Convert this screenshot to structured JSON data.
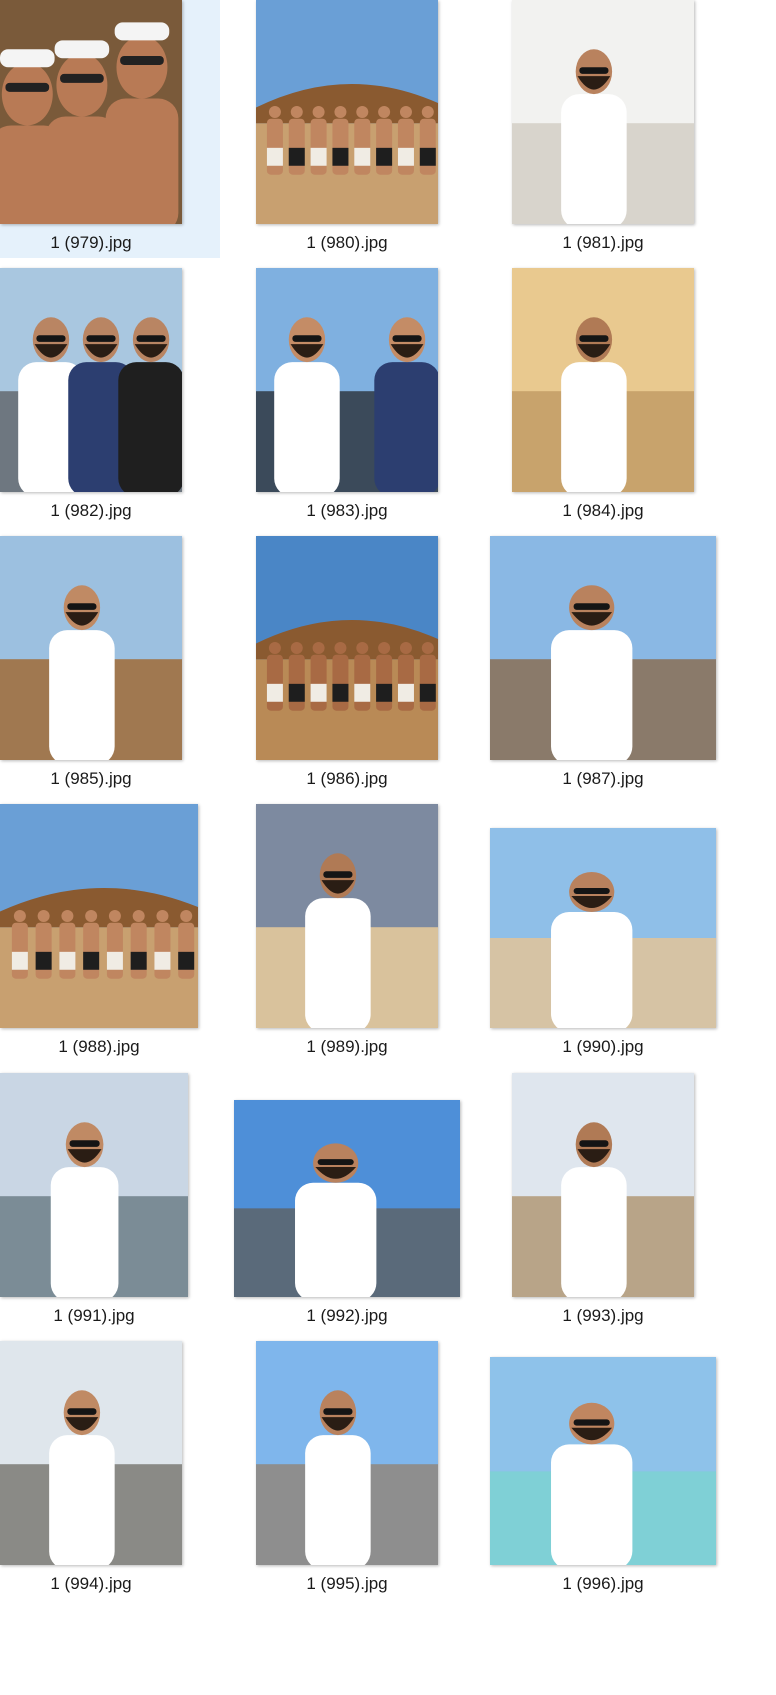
{
  "window": {
    "view": "Large icons",
    "selected_file": "1 (979).jpg"
  },
  "colors": {
    "selection": "#e5f1fb",
    "label_text": "#1a1a1a"
  },
  "files": [
    {
      "name": "1 (979).jpg",
      "selected": true,
      "scene": "selfie",
      "sky": "#c89a62",
      "ground": "#7a5a3a",
      "skin": "#b87a55"
    },
    {
      "name": "1 (980).jpg",
      "selected": false,
      "scene": "beach-group",
      "sky": "#6a9fd6",
      "ground": "#c8a070",
      "skin": "#c08660"
    },
    {
      "name": "1 (981).jpg",
      "selected": false,
      "scene": "street",
      "sky": "#f2f2f0",
      "ground": "#d8d4cc",
      "skin": "#b9825e"
    },
    {
      "name": "1 (982).jpg",
      "selected": false,
      "scene": "coast-group",
      "sky": "#a9c7e0",
      "ground": "#6e7780",
      "skin": "#b98563"
    },
    {
      "name": "1 (983).jpg",
      "selected": false,
      "scene": "city-selfie",
      "sky": "#7fb0e0",
      "ground": "#3b4a5a",
      "skin": "#c48c66"
    },
    {
      "name": "1 (984).jpg",
      "selected": false,
      "scene": "sunset-beach",
      "sky": "#e9c98f",
      "ground": "#c8a36c",
      "skin": "#b07a55"
    },
    {
      "name": "1 (985).jpg",
      "selected": false,
      "scene": "beach-club",
      "sky": "#9cc0e0",
      "ground": "#a07850",
      "skin": "#c08a64"
    },
    {
      "name": "1 (986).jpg",
      "selected": false,
      "scene": "tilted-group",
      "sky": "#4a86c6",
      "ground": "#b98a56",
      "skin": "#a86a44"
    },
    {
      "name": "1 (987).jpg",
      "selected": false,
      "scene": "rock-sea",
      "sky": "#8ab8e4",
      "ground": "#8a7a6a",
      "skin": "#b9825e"
    },
    {
      "name": "1 (988).jpg",
      "selected": false,
      "scene": "beach-group",
      "sky": "#6a9fd6",
      "ground": "#c8a070",
      "skin": "#c08660"
    },
    {
      "name": "1 (989).jpg",
      "selected": false,
      "scene": "shore",
      "sky": "#7d8aa0",
      "ground": "#d9c29c",
      "skin": "#b07a55"
    },
    {
      "name": "1 (990).jpg",
      "selected": false,
      "scene": "windmill",
      "sky": "#8fbfe8",
      "ground": "#d6c3a4",
      "skin": "#b9825e"
    },
    {
      "name": "1 (991).jpg",
      "selected": false,
      "scene": "bridge",
      "sky": "#c9d6e4",
      "ground": "#7b8c96",
      "skin": "#c08a64"
    },
    {
      "name": "1 (992).jpg",
      "selected": false,
      "scene": "wheel",
      "sky": "#4e8fd8",
      "ground": "#5a6a7a",
      "skin": "#b9825e"
    },
    {
      "name": "1 (993).jpg",
      "selected": false,
      "scene": "cathedral",
      "sky": "#dfe6ee",
      "ground": "#b8a488",
      "skin": "#b07a55"
    },
    {
      "name": "1 (994).jpg",
      "selected": false,
      "scene": "lane",
      "sky": "#dfe6ec",
      "ground": "#8a8a86",
      "skin": "#c08a64"
    },
    {
      "name": "1 (995).jpg",
      "selected": false,
      "scene": "promenade",
      "sky": "#7fb6ec",
      "ground": "#8e8e8e",
      "skin": "#b9825e"
    },
    {
      "name": "1 (996).jpg",
      "selected": false,
      "scene": "lagoon",
      "sky": "#8ec2ea",
      "ground": "#7fd0d6",
      "skin": "#c08660"
    }
  ]
}
